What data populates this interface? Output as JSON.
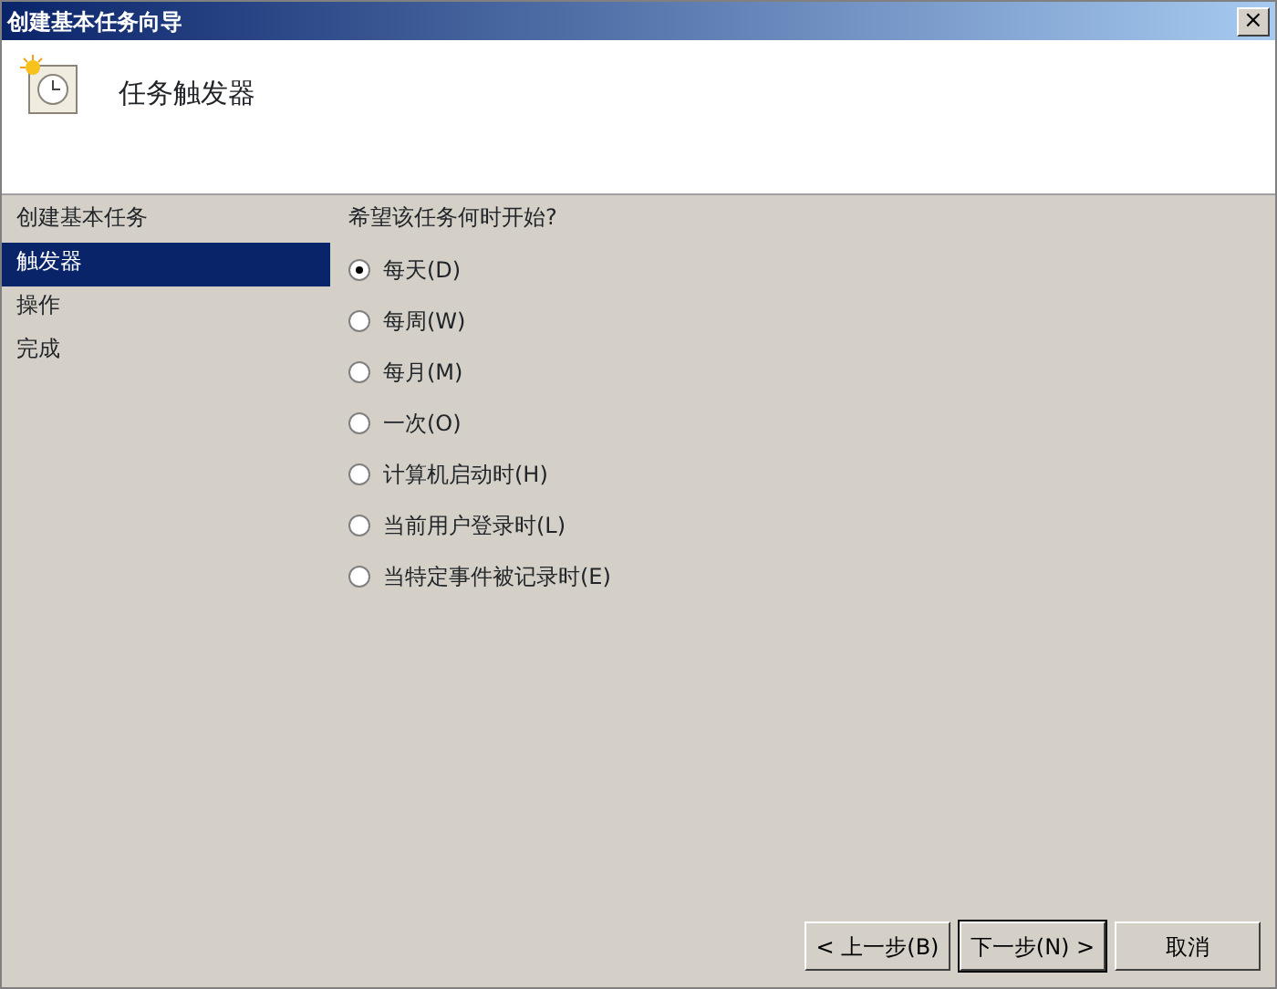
{
  "window": {
    "title": "创建基本任务向导",
    "close": "×"
  },
  "header": {
    "title": "任务触发器"
  },
  "steps": [
    {
      "label": "创建基本任务",
      "selected": false
    },
    {
      "label": "触发器",
      "selected": true
    },
    {
      "label": "操作",
      "selected": false
    },
    {
      "label": "完成",
      "selected": false
    }
  ],
  "question": "希望该任务何时开始?",
  "options": [
    {
      "label": "每天(D)",
      "selected": true
    },
    {
      "label": "每周(W)",
      "selected": false
    },
    {
      "label": "每月(M)",
      "selected": false
    },
    {
      "label": "一次(O)",
      "selected": false
    },
    {
      "label": "计算机启动时(H)",
      "selected": false
    },
    {
      "label": "当前用户登录时(L)",
      "selected": false
    },
    {
      "label": "当特定事件被记录时(E)",
      "selected": false
    }
  ],
  "buttons": [
    {
      "label": "< 上一步(B)"
    },
    {
      "label": "下一步(N) >"
    },
    {
      "label": "取消"
    }
  ]
}
